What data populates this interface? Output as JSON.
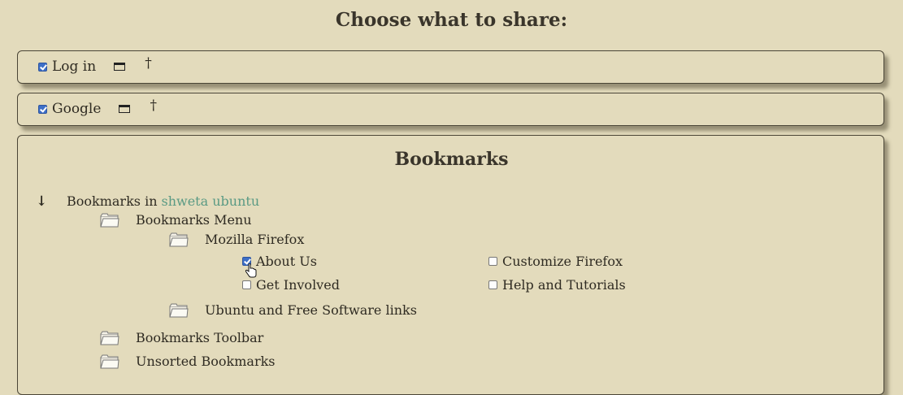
{
  "page": {
    "title": "Choose what to share:"
  },
  "services": [
    {
      "label": "Log in",
      "checked": true
    },
    {
      "label": "Google",
      "checked": true
    }
  ],
  "bookmarks": {
    "title": "Bookmarks",
    "root_prefix": "Bookmarks in",
    "root_host": "shweta ubuntu",
    "menu": "Bookmarks Menu",
    "mozilla_folder": "Mozilla Firefox",
    "items": [
      {
        "label": "About Us",
        "checked": true
      },
      {
        "label": "Customize Firefox",
        "checked": false
      },
      {
        "label": "Get Involved",
        "checked": false
      },
      {
        "label": "Help and Tutorials",
        "checked": false
      }
    ],
    "ubuntu_folder": "Ubuntu and Free Software links",
    "toolbar": "Bookmarks Toolbar",
    "unsorted": "Unsorted Bookmarks"
  },
  "colors": {
    "background": "#e3dbbc",
    "host_link": "#5a9a84",
    "checkbox_checked": "#3d6fc7"
  }
}
